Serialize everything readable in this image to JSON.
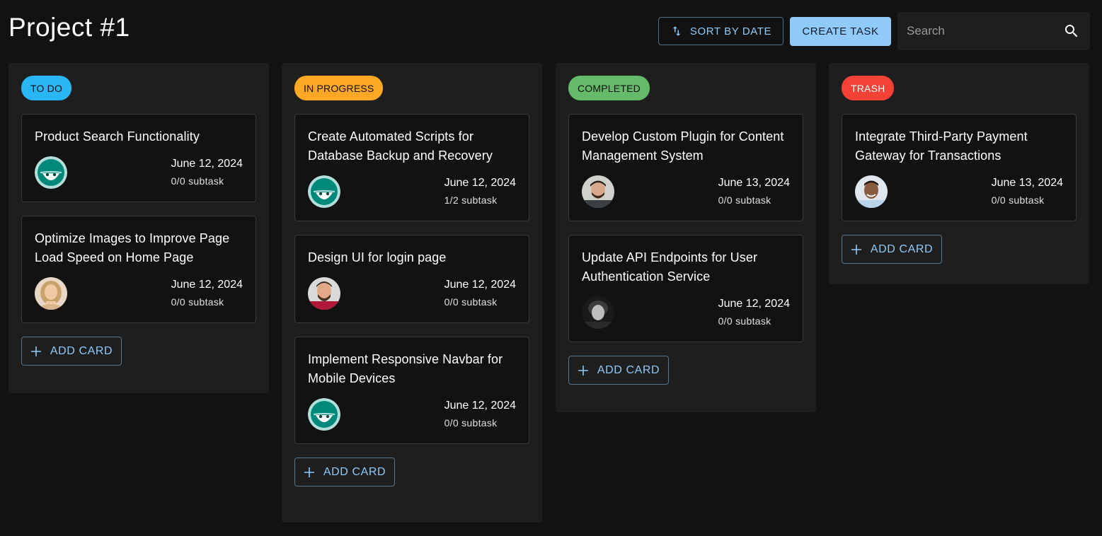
{
  "header": {
    "title": "Project #1",
    "sort_label": "SORT BY DATE",
    "create_label": "CREATE TASK",
    "search_placeholder": "Search"
  },
  "add_card_label": "ADD CARD",
  "colors": {
    "todo": "#29b6f6",
    "in_progress": "#ffa726",
    "completed": "#66bb6a",
    "trash": "#f44336",
    "accent": "#90caf9"
  },
  "columns": [
    {
      "status": "TO DO",
      "cards": [
        {
          "title": "Product Search Functionality",
          "date": "June 12, 2024",
          "subtask": "0/0 subtask",
          "avatar": "default-avatar-icon"
        },
        {
          "title": "Optimize Images to Improve Page Load Speed on Home Page",
          "date": "June 12, 2024",
          "subtask": "0/0 subtask",
          "avatar": "user-photo-avatar"
        }
      ]
    },
    {
      "status": "IN PROGRESS",
      "cards": [
        {
          "title": "Create Automated Scripts for Database Backup and Recovery",
          "date": "June 12, 2024",
          "subtask": "1/2 subtask",
          "avatar": "default-avatar-icon"
        },
        {
          "title": "Design UI for login page",
          "date": "June 12, 2024",
          "subtask": "0/0 subtask",
          "avatar": "user-photo-avatar"
        },
        {
          "title": "Implement Responsive Navbar for Mobile Devices",
          "date": "June 12, 2024",
          "subtask": "0/0 subtask",
          "avatar": "default-avatar-icon"
        }
      ]
    },
    {
      "status": "COMPLETED",
      "cards": [
        {
          "title": "Develop Custom Plugin for Content Management System",
          "date": "June 13, 2024",
          "subtask": "0/0 subtask",
          "avatar": "user-photo-avatar"
        },
        {
          "title": "Update API Endpoints for User Authentication Service",
          "date": "June 12, 2024",
          "subtask": "0/0 subtask",
          "avatar": "user-photo-avatar"
        }
      ]
    },
    {
      "status": "TRASH",
      "cards": [
        {
          "title": "Integrate Third-Party Payment Gateway for Transactions",
          "date": "June 13, 2024",
          "subtask": "0/0 subtask",
          "avatar": "user-photo-avatar"
        }
      ]
    }
  ]
}
